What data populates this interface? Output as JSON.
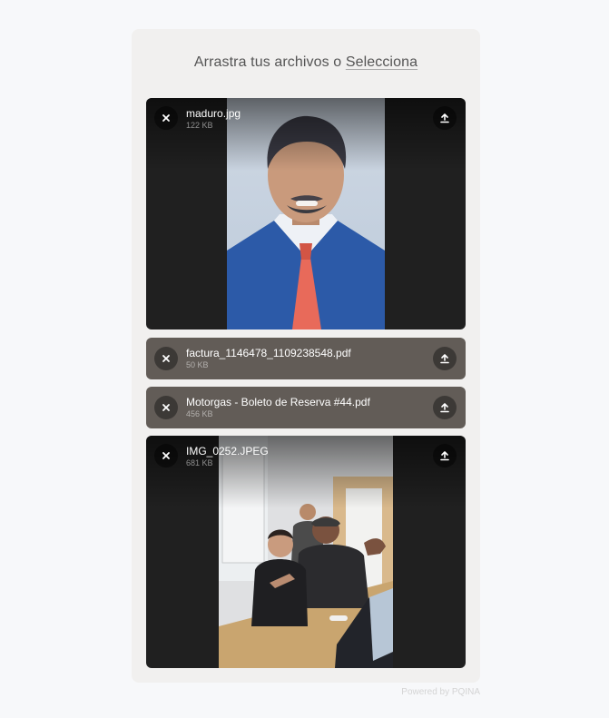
{
  "dropzone": {
    "label_text": "Arrastra tus archivos o ",
    "browse_label": "Selecciona"
  },
  "files": [
    {
      "name": "maduro.jpg",
      "size": "122 KB",
      "kind": "image",
      "remove_icon": "close-icon",
      "upload_icon": "upload-icon"
    },
    {
      "name": "factura_1146478_1109238548.pdf",
      "size": "50 KB",
      "kind": "file",
      "remove_icon": "close-icon",
      "upload_icon": "upload-icon"
    },
    {
      "name": "Motorgas - Boleto de Reserva #44.pdf",
      "size": "456 KB",
      "kind": "file",
      "remove_icon": "close-icon",
      "upload_icon": "upload-icon"
    },
    {
      "name": "IMG_0252.JPEG",
      "size": "681 KB",
      "kind": "image",
      "remove_icon": "close-icon",
      "upload_icon": "upload-icon"
    }
  ],
  "credits": {
    "text": "Powered by PQINA"
  },
  "colors": {
    "page_background": "#f7f8fa",
    "panel_background": "#f1f0ef",
    "file_item_background": "#625c57",
    "image_item_background": "#202020"
  }
}
